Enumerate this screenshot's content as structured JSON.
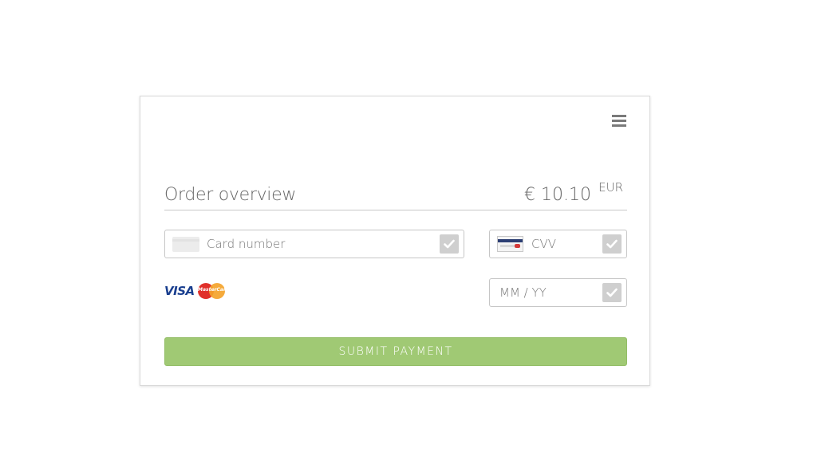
{
  "order": {
    "title": "Order overview",
    "amount": "€ 10.10",
    "currency": "EUR"
  },
  "fields": {
    "card_number": {
      "placeholder": "Card number",
      "value": ""
    },
    "cvv": {
      "placeholder": "CVV",
      "value": ""
    },
    "expiry": {
      "placeholder": "MM / YY",
      "value": ""
    }
  },
  "brands": {
    "visa": "VISA",
    "mastercard": "MasterCard"
  },
  "submit": {
    "label": "SUBMIT PAYMENT"
  },
  "icons": {
    "menu": "hamburger-menu-icon",
    "card": "credit-card-icon",
    "cvv": "card-back-icon",
    "check": "checkmark-icon"
  },
  "colors": {
    "submit_bg": "#a0c974",
    "check_bg": "#cfcfcf",
    "border": "#c6c6c6"
  }
}
